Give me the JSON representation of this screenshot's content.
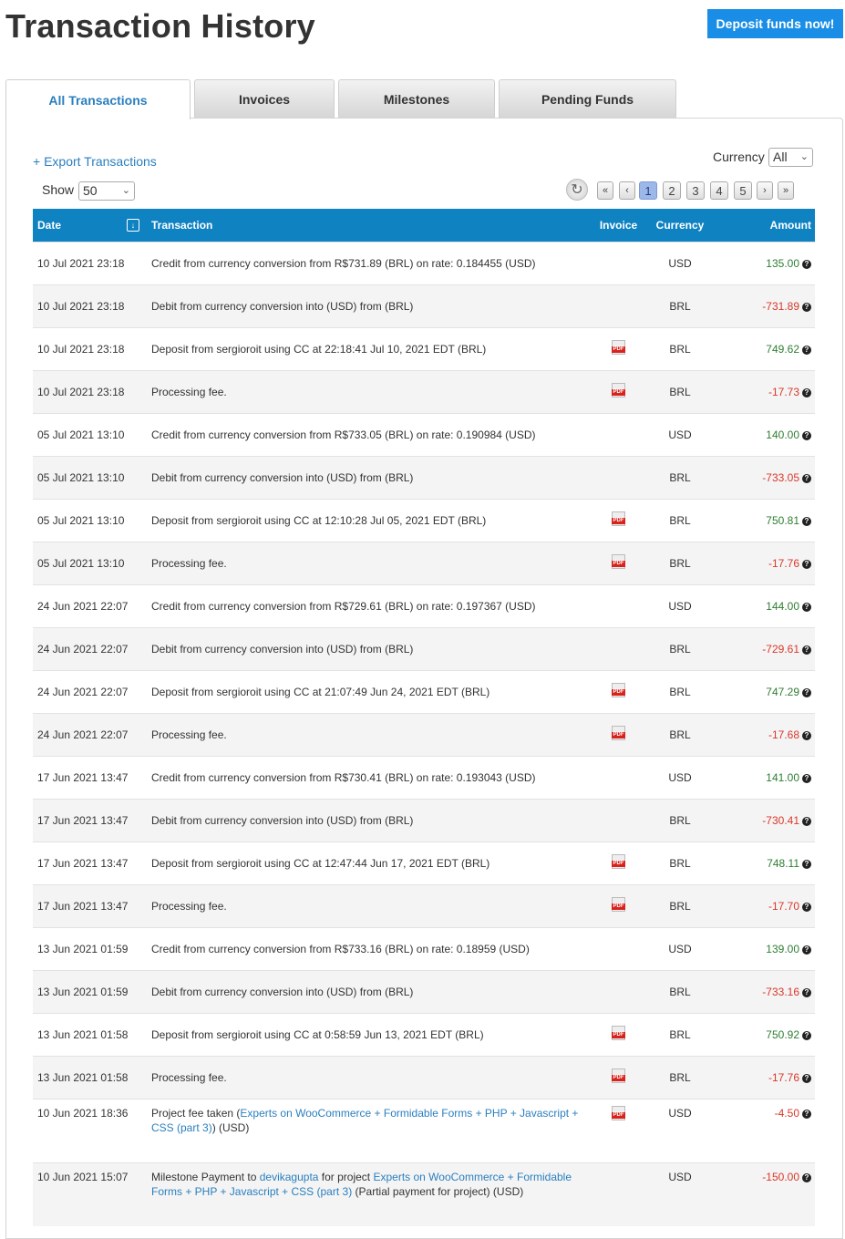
{
  "header": {
    "title": "Transaction History",
    "deposit_label": "Deposit funds now!"
  },
  "tabs": [
    {
      "label": "All Transactions",
      "active": true
    },
    {
      "label": "Invoices"
    },
    {
      "label": "Milestones"
    },
    {
      "label": "Pending Funds"
    }
  ],
  "toolbar": {
    "export_label": "+ Export Transactions",
    "currency_label": "Currency",
    "currency_value": "All",
    "show_label": "Show",
    "show_value": "50",
    "pager": {
      "first": "«",
      "prev": "‹",
      "pages": [
        "1",
        "2",
        "3",
        "4",
        "5"
      ],
      "current": "1",
      "next": "›",
      "last": "»"
    }
  },
  "table": {
    "headers": {
      "date": "Date",
      "transaction": "Transaction",
      "invoice": "Invoice",
      "currency": "Currency",
      "amount": "Amount"
    },
    "rows": [
      {
        "date": "10 Jul 2021 23:18",
        "desc": "Credit from currency conversion from R$731.89 (BRL) on rate: 0.184455 (USD)",
        "pdf": false,
        "currency": "USD",
        "amount": "135.00",
        "neg": false
      },
      {
        "date": "10 Jul 2021 23:18",
        "desc": "Debit from currency conversion into (USD) from (BRL)",
        "pdf": false,
        "currency": "BRL",
        "amount": "-731.89",
        "neg": true
      },
      {
        "date": "10 Jul 2021 23:18",
        "desc": "Deposit from sergioroit using CC at 22:18:41 Jul 10, 2021 EDT (BRL)",
        "pdf": true,
        "currency": "BRL",
        "amount": "749.62",
        "neg": false
      },
      {
        "date": "10 Jul 2021 23:18",
        "desc": "Processing fee.",
        "pdf": true,
        "currency": "BRL",
        "amount": "-17.73",
        "neg": true
      },
      {
        "date": "05 Jul 2021 13:10",
        "desc": "Credit from currency conversion from R$733.05 (BRL) on rate: 0.190984 (USD)",
        "pdf": false,
        "currency": "USD",
        "amount": "140.00",
        "neg": false
      },
      {
        "date": "05 Jul 2021 13:10",
        "desc": "Debit from currency conversion into (USD) from (BRL)",
        "pdf": false,
        "currency": "BRL",
        "amount": "-733.05",
        "neg": true
      },
      {
        "date": "05 Jul 2021 13:10",
        "desc": "Deposit from sergioroit using CC at 12:10:28 Jul 05, 2021 EDT (BRL)",
        "pdf": true,
        "currency": "BRL",
        "amount": "750.81",
        "neg": false
      },
      {
        "date": "05 Jul 2021 13:10",
        "desc": "Processing fee.",
        "pdf": true,
        "currency": "BRL",
        "amount": "-17.76",
        "neg": true
      },
      {
        "date": "24 Jun 2021 22:07",
        "desc": "Credit from currency conversion from R$729.61 (BRL) on rate: 0.197367 (USD)",
        "pdf": false,
        "currency": "USD",
        "amount": "144.00",
        "neg": false
      },
      {
        "date": "24 Jun 2021 22:07",
        "desc": "Debit from currency conversion into (USD) from (BRL)",
        "pdf": false,
        "currency": "BRL",
        "amount": "-729.61",
        "neg": true
      },
      {
        "date": "24 Jun 2021 22:07",
        "desc": "Deposit from sergioroit using CC at 21:07:49 Jun 24, 2021 EDT (BRL)",
        "pdf": true,
        "currency": "BRL",
        "amount": "747.29",
        "neg": false
      },
      {
        "date": "24 Jun 2021 22:07",
        "desc": "Processing fee.",
        "pdf": true,
        "currency": "BRL",
        "amount": "-17.68",
        "neg": true
      },
      {
        "date": "17 Jun 2021 13:47",
        "desc": "Credit from currency conversion from R$730.41 (BRL) on rate: 0.193043 (USD)",
        "pdf": false,
        "currency": "USD",
        "amount": "141.00",
        "neg": false
      },
      {
        "date": "17 Jun 2021 13:47",
        "desc": "Debit from currency conversion into (USD) from (BRL)",
        "pdf": false,
        "currency": "BRL",
        "amount": "-730.41",
        "neg": true
      },
      {
        "date": "17 Jun 2021 13:47",
        "desc": "Deposit from sergioroit using CC at 12:47:44 Jun 17, 2021 EDT (BRL)",
        "pdf": true,
        "currency": "BRL",
        "amount": "748.11",
        "neg": false
      },
      {
        "date": "17 Jun 2021 13:47",
        "desc": "Processing fee.",
        "pdf": true,
        "currency": "BRL",
        "amount": "-17.70",
        "neg": true
      },
      {
        "date": "13 Jun 2021 01:59",
        "desc": "Credit from currency conversion from R$733.16 (BRL) on rate: 0.18959 (USD)",
        "pdf": false,
        "currency": "USD",
        "amount": "139.00",
        "neg": false
      },
      {
        "date": "13 Jun 2021 01:59",
        "desc": "Debit from currency conversion into (USD) from (BRL)",
        "pdf": false,
        "currency": "BRL",
        "amount": "-733.16",
        "neg": true
      },
      {
        "date": "13 Jun 2021 01:58",
        "desc": "Deposit from sergioroit using CC at 0:58:59 Jun 13, 2021 EDT (BRL)",
        "pdf": true,
        "currency": "BRL",
        "amount": "750.92",
        "neg": false
      },
      {
        "date": "13 Jun 2021 01:58",
        "desc": "Processing fee.",
        "pdf": true,
        "currency": "BRL",
        "amount": "-17.76",
        "neg": true
      },
      {
        "date": "10 Jun 2021 18:36",
        "desc_parts": [
          {
            "t": "Project fee taken ("
          },
          {
            "t": "Experts on WooCommerce + Formidable Forms + PHP + Javascript + CSS (part 3)",
            "link": true
          },
          {
            "t": ") (USD)"
          }
        ],
        "pdf": true,
        "currency": "USD",
        "amount": "-4.50",
        "neg": true
      },
      {
        "date": "10 Jun 2021 15:07",
        "desc_parts": [
          {
            "t": "Milestone Payment to "
          },
          {
            "t": "devikagupta",
            "link": true
          },
          {
            "t": " for project "
          },
          {
            "t": "Experts on WooCommerce + Formidable Forms + PHP + Javascript + CSS (part 3)",
            "link": true
          },
          {
            "t": " (Partial payment for project) (USD)"
          }
        ],
        "pdf": false,
        "currency": "USD",
        "amount": "-150.00",
        "neg": true
      }
    ]
  },
  "colors": {
    "header_bg": "#0f82c2",
    "positive": "#2e7d32",
    "negative": "#d9382a",
    "accent": "#1a8ee6"
  },
  "icons": {
    "refresh": "refresh-icon",
    "sort": "sort-down-icon",
    "pdf": "pdf-icon",
    "help": "question-circle-icon"
  }
}
